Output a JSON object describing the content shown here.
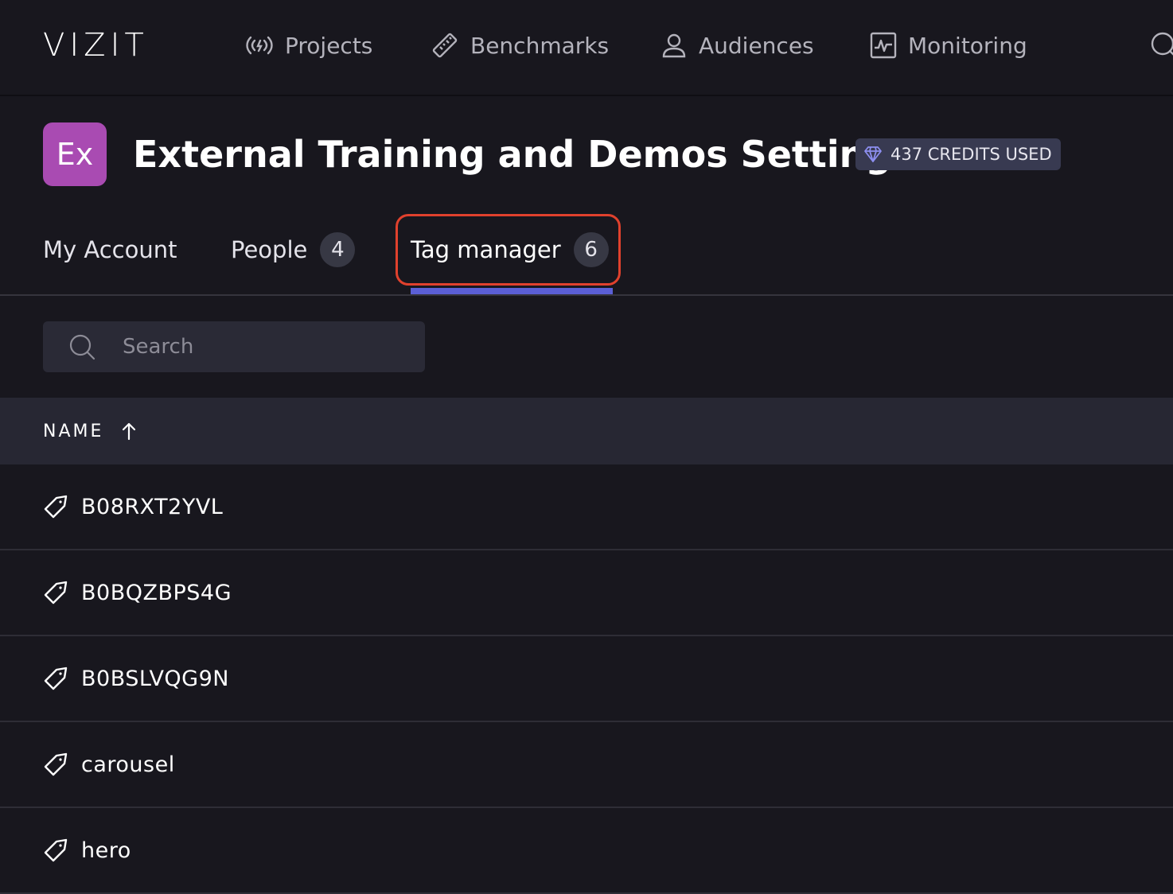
{
  "app": {
    "logo": "VIZIT"
  },
  "nav": {
    "items": [
      {
        "label": "Projects",
        "icon": "broadcast-icon"
      },
      {
        "label": "Benchmarks",
        "icon": "ruler-icon"
      },
      {
        "label": "Audiences",
        "icon": "user-icon"
      },
      {
        "label": "Monitoring",
        "icon": "pulse-monitor-icon"
      }
    ],
    "search_icon": "search-icon"
  },
  "header": {
    "avatar_text": "Ex",
    "avatar_color": "#a94bb2",
    "title": "External Training and Demos Settings",
    "credits": "437 CREDITS USED"
  },
  "tabs": [
    {
      "label": "My Account",
      "count": null
    },
    {
      "label": "People",
      "count": "4"
    },
    {
      "label": "Tag manager",
      "count": "6",
      "active": true
    }
  ],
  "search": {
    "placeholder": "Search",
    "value": ""
  },
  "table": {
    "columns": [
      {
        "label": "NAME",
        "sort": "ascending"
      }
    ],
    "rows": [
      {
        "name": "B08RXT2YVL"
      },
      {
        "name": "B0BQZBPS4G"
      },
      {
        "name": "B0BSLVQG9N"
      },
      {
        "name": "carousel"
      },
      {
        "name": "hero"
      }
    ]
  },
  "colors": {
    "background": "#18171e",
    "accent": "#5b5fd6",
    "highlight": "#e0412d"
  }
}
